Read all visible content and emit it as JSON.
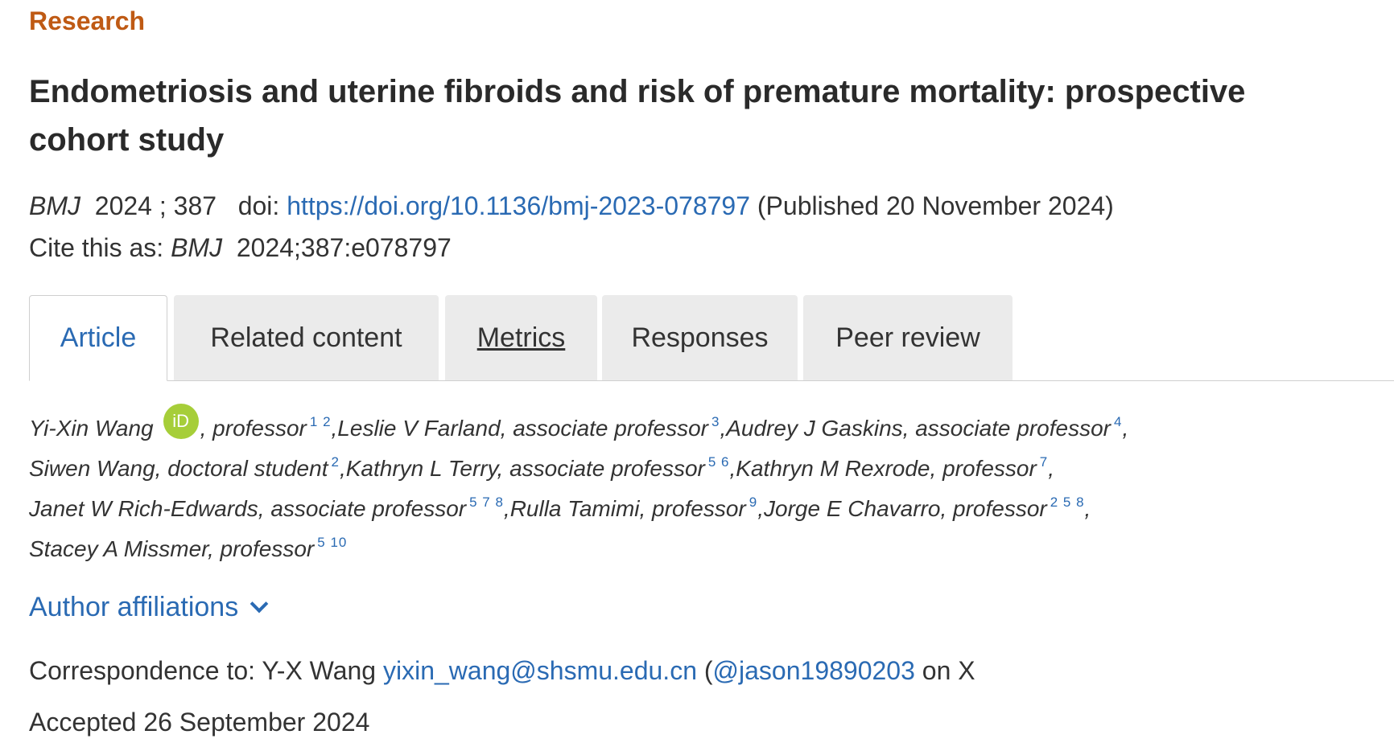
{
  "section_label": "Research",
  "title": "Endometriosis and uterine fibroids and risk of premature mortality: prospective cohort study",
  "citation": {
    "journal": "BMJ",
    "year": "2024",
    "sep": ";",
    "volume": "387",
    "doi_label": "doi:",
    "doi_url": "https://doi.org/10.1136/bmj-2023-078797",
    "published": "(Published 20 November 2024)",
    "cite_as_label": "Cite this as:",
    "cite_as_value": "2024;387:e078797"
  },
  "tabs": [
    {
      "label": "Article",
      "active": true
    },
    {
      "label": "Related content",
      "active": false
    },
    {
      "label": "Metrics",
      "active": false
    },
    {
      "label": "Responses",
      "active": false
    },
    {
      "label": "Peer review",
      "active": false
    }
  ],
  "orcid_label": "iD",
  "authors": {
    "a1_name": "Yi-Xin Wang",
    "a1_role": ", professor",
    "a1_aff": "1 2",
    "a2": ",Leslie V Farland, associate professor",
    "a2_aff": "3",
    "a3": ",Audrey J Gaskins, associate professor",
    "a3_aff": "4",
    "a3_tail": ",",
    "a4": "Siwen Wang, doctoral student",
    "a4_aff": "2",
    "a5": ",Kathryn L Terry, associate professor",
    "a5_aff": "5 6",
    "a6": ",Kathryn M Rexrode, professor",
    "a6_aff": "7",
    "a6_tail": ",",
    "a7": "Janet W Rich-Edwards, associate professor",
    "a7_aff": "5 7 8",
    "a8": ",Rulla Tamimi, professor",
    "a8_aff": "9",
    "a9": ",Jorge E Chavarro, professor",
    "a9_aff": "2 5 8",
    "a9_tail": ",",
    "a10": "Stacey A Missmer, professor",
    "a10_aff": "5 10"
  },
  "author_affiliations_label": "Author affiliations",
  "correspondence": {
    "prefix": "Correspondence to: Y-X Wang",
    "email": "yixin_wang@shsmu.edu.cn",
    "open": "(",
    "handle": "@jason19890203",
    "suffix": "on X"
  },
  "accepted": "Accepted 26 September 2024"
}
